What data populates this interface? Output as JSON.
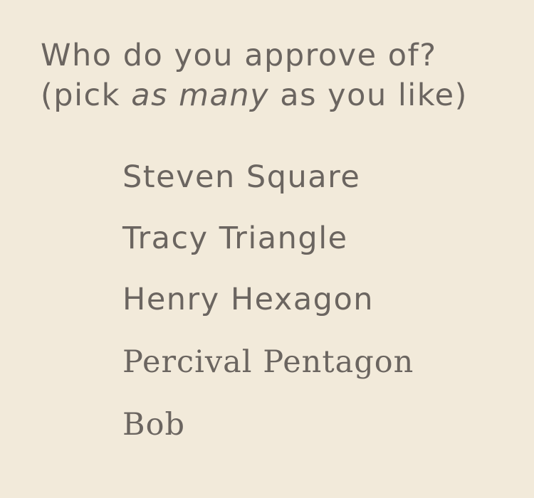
{
  "question": {
    "line1": "Who do you approve of?",
    "line2_before": "(pick ",
    "line2_emphasis": "as many",
    "line2_after": " as you like)"
  },
  "candidates": [
    {
      "label": "Steven Square"
    },
    {
      "label": "Tracy Triangle"
    },
    {
      "label": "Henry Hexagon"
    },
    {
      "label": "Percival Pentagon"
    },
    {
      "label": "Bob"
    }
  ],
  "colors": {
    "background": "#f2eada",
    "text": "#6b6560"
  }
}
